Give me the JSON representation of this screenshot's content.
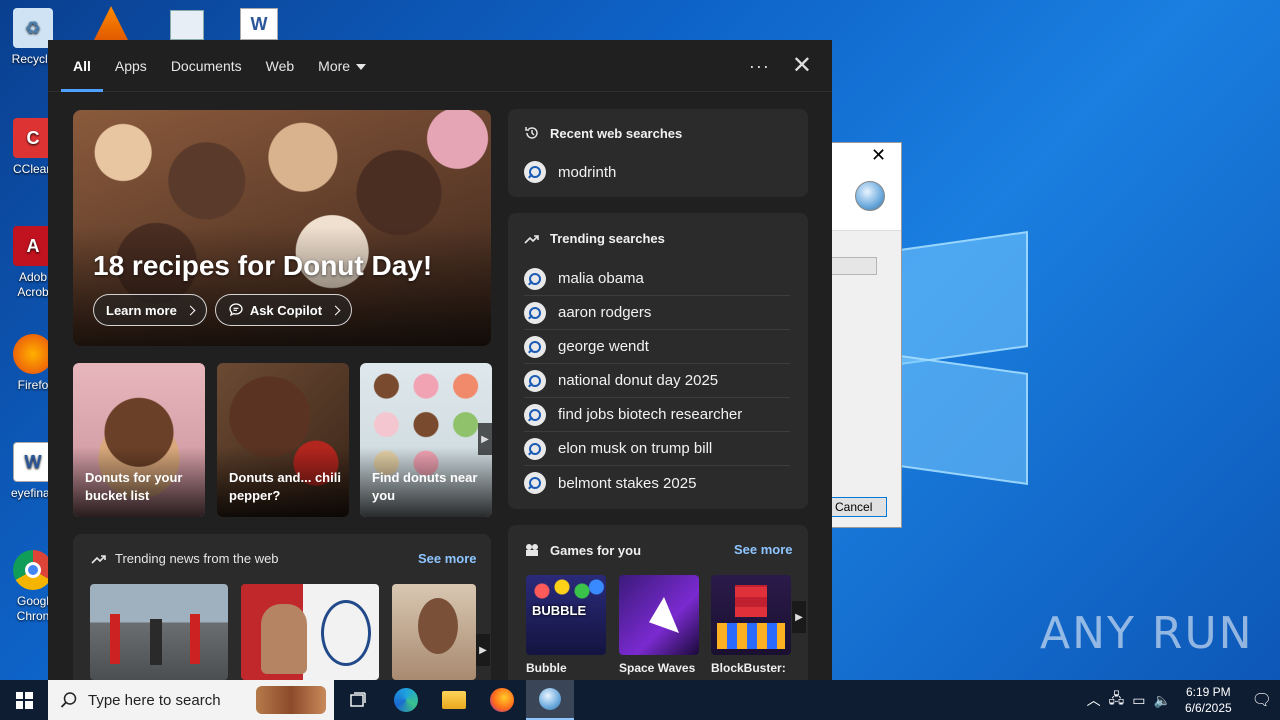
{
  "desktop": {
    "icons": [
      {
        "label": "Recycle",
        "icon": "recycle-bin-icon"
      },
      {
        "label": "CClean",
        "icon": "ccleaner-icon"
      },
      {
        "label": "Adob Acrob",
        "icon": "acrobat-icon"
      },
      {
        "label": "Firefo",
        "icon": "firefox-icon"
      },
      {
        "label": "eyefinall",
        "icon": "word-doc-icon"
      },
      {
        "label": "Googl Chron",
        "icon": "chrome-icon"
      }
    ],
    "watermark": "ANY RUN"
  },
  "background_dialog": {
    "cancel_label": "Cancel"
  },
  "search_panel": {
    "tabs": [
      {
        "label": "All",
        "active": true
      },
      {
        "label": "Apps"
      },
      {
        "label": "Documents"
      },
      {
        "label": "Web"
      },
      {
        "label": "More"
      }
    ],
    "more_options": "···",
    "close": "✕",
    "hero": {
      "title": "18 recipes for Donut Day!",
      "learn_more": "Learn more",
      "ask_copilot": "Ask Copilot"
    },
    "cards": [
      {
        "label": "Donuts for your bucket list"
      },
      {
        "label": "Donuts and... chili pepper?"
      },
      {
        "label": "Find donuts near you"
      }
    ],
    "news": {
      "heading": "Trending news from the web",
      "see_more": "See more"
    },
    "recent": {
      "heading": "Recent web searches",
      "items": [
        "modrinth"
      ]
    },
    "trending": {
      "heading": "Trending searches",
      "items": [
        "malia obama",
        "aaron rodgers",
        "george wendt",
        "national donut day 2025",
        "find jobs biotech researcher",
        "elon musk on trump bill",
        "belmont stakes 2025"
      ]
    },
    "games": {
      "heading": "Games for you",
      "see_more": "See more",
      "items": [
        "Bubble",
        "Space Waves",
        "BlockBuster:"
      ]
    }
  },
  "taskbar": {
    "search_placeholder": "Type here to search",
    "time": "6:19 PM",
    "date": "6/6/2025"
  },
  "colors": {
    "panel_bg": "#202020",
    "card_bg": "#2b2b2b",
    "accent": "#4ea1ff",
    "link": "#8ec5ff"
  }
}
